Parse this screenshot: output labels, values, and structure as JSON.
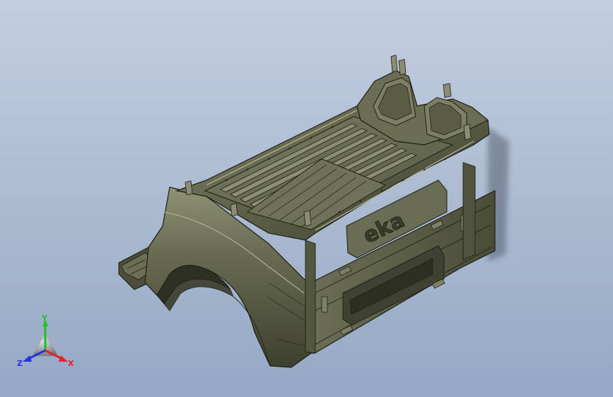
{
  "viewport": {
    "background_top": "#c3cfe0",
    "background_bottom": "#95a8c4"
  },
  "model": {
    "name": "pickup-truck-cargo-bed",
    "body_color": "#5f6248",
    "edge_color": "#1d1e15",
    "highlight_color": "#a7a98e",
    "logo_text": "eka"
  },
  "triad": {
    "x_label": "X",
    "y_label": "Y",
    "z_label": "Z",
    "x_color": "#e0242b",
    "y_color": "#1fbf2b",
    "z_color": "#2735d8"
  }
}
